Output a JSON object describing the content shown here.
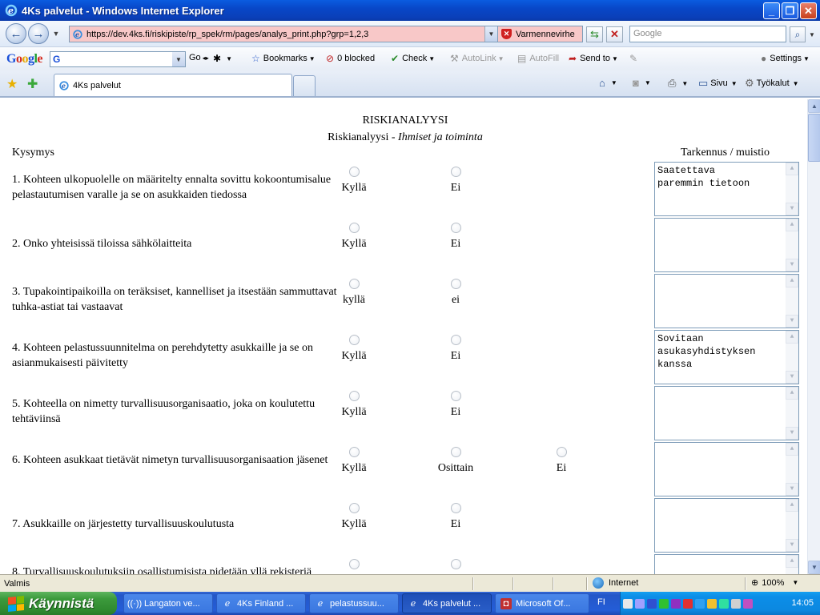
{
  "window": {
    "title": "4Ks palvelut - Windows Internet Explorer"
  },
  "address_bar": {
    "url": "https://dev.4ks.fi/riskipiste/rp_spek/rm/pages/analys_print.php?grp=1,2,3",
    "cert_error": "Varmennevirhe",
    "search_placeholder": "Google"
  },
  "google_toolbar": {
    "logo": "Google",
    "go_label": "Go",
    "bookmarks_label": "Bookmarks",
    "blocked_label": "0 blocked",
    "check_label": "Check",
    "autolink_label": "AutoLink",
    "autofill_label": "AutoFill",
    "sendto_label": "Send to",
    "settings_label": "Settings"
  },
  "tabs": [
    {
      "label": "4Ks palvelut"
    }
  ],
  "command_bar": {
    "sivu_label": "Sivu",
    "tyokalut_label": "Työkalut"
  },
  "document": {
    "title": "RISKIANALYYSI",
    "subtitle_prefix": "Riskianalyysi - ",
    "subtitle_italic": "Ihmiset ja toiminta",
    "col_question": "Kysymys",
    "col_notes": "Tarkennus / muistio",
    "questions": [
      {
        "text": "1. Kohteen ulkopuolelle on määritelty ennalta sovittu kokoontumisalue pelastautumisen varalle ja se on asukkaiden tiedossa",
        "options": [
          "Kyllä",
          "Ei"
        ],
        "note": "Saatettava\nparemmin tietoon"
      },
      {
        "text": "2. Onko yhteisissä tiloissa sähkölaitteita",
        "options": [
          "Kyllä",
          "Ei"
        ],
        "note": ""
      },
      {
        "text": "3. Tupakointipaikoilla on teräksiset, kannelliset ja itsestään sammuttavat tuhka-astiat tai vastaavat",
        "options": [
          "kyllä",
          "ei"
        ],
        "note": ""
      },
      {
        "text": "4. Kohteen pelastussuunnitelma on perehdytetty asukkaille ja se on asianmukaisesti päivitetty",
        "options": [
          "Kyllä",
          "Ei"
        ],
        "note": "Sovitaan\nasukasyhdistyksen\nkanssa"
      },
      {
        "text": "5. Kohteella on nimetty turvallisuusorganisaatio, joka on koulutettu tehtäviinsä",
        "options": [
          "Kyllä",
          "Ei"
        ],
        "note": ""
      },
      {
        "text": "6. Kohteen asukkaat tietävät nimetyn turvallisuusorganisaation jäsenet",
        "options": [
          "Kyllä",
          "Osittain",
          "Ei"
        ],
        "note": ""
      },
      {
        "text": "7. Asukkaille on järjestetty turvallisuuskoulutusta",
        "options": [
          "Kyllä",
          "Ei"
        ],
        "note": ""
      },
      {
        "text": "8. Turvallisuuskoulutuksiin osallistumisista pidetään yllä rekisteriä",
        "options": [
          "",
          ""
        ],
        "note": ""
      }
    ]
  },
  "status_bar": {
    "status": "Valmis",
    "zone": "Internet",
    "zoom": "100%"
  },
  "taskbar": {
    "start_label": "Käynnistä",
    "tasks": [
      {
        "label": "Langaton ve..."
      },
      {
        "label": "4Ks Finland ..."
      },
      {
        "label": "pelastussuu..."
      },
      {
        "label": "4Ks palvelut ..."
      },
      {
        "label": "Microsoft Of..."
      }
    ],
    "language": "FI",
    "clock": "14:05"
  },
  "colors": {
    "title_bar": "#0a5ce0",
    "address_error_bg": "#f8c8c8",
    "taskbar": "#245dd7",
    "start_button": "#3c9a3c"
  }
}
